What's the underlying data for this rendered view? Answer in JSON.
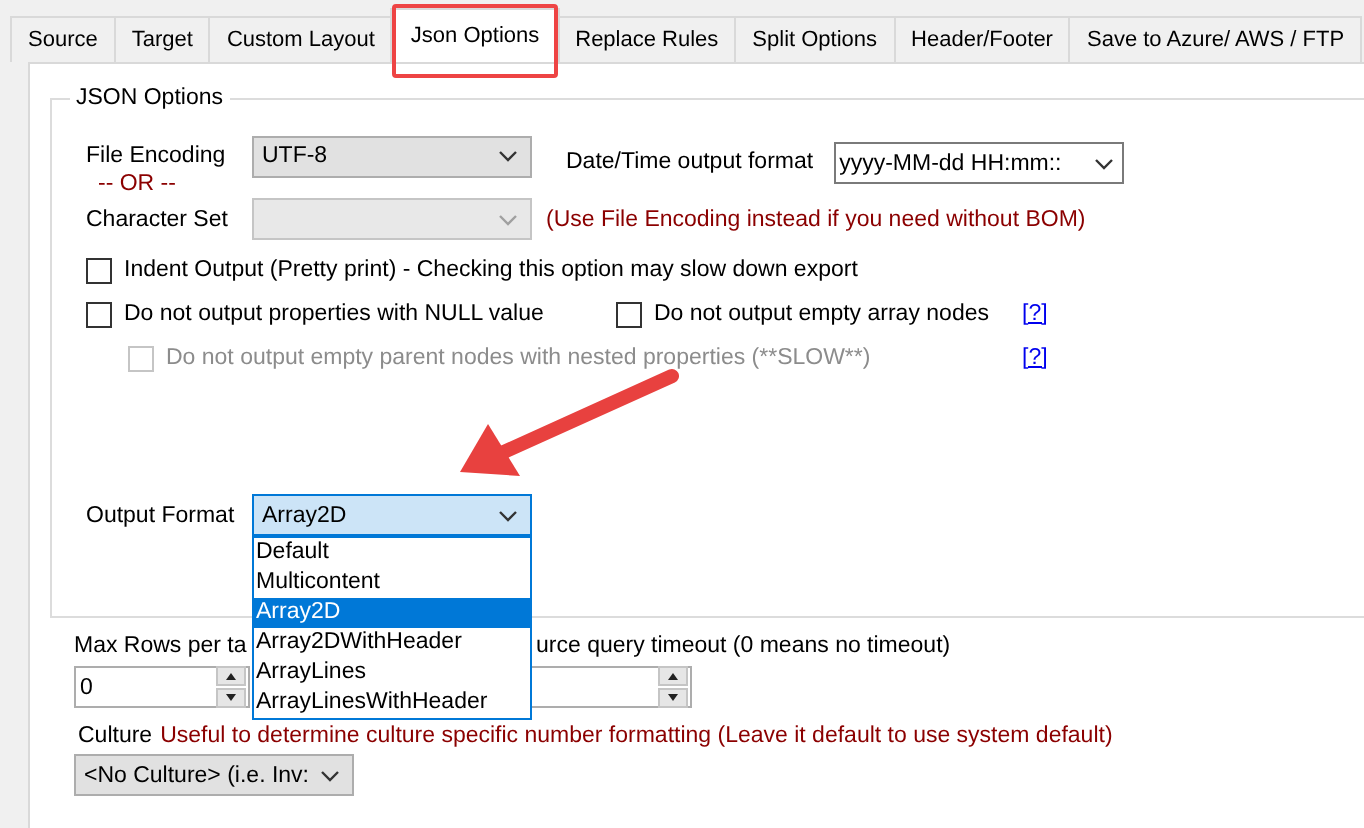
{
  "tabs": [
    {
      "label": "Source",
      "selected": false
    },
    {
      "label": "Target",
      "selected": false
    },
    {
      "label": "Custom Layout",
      "selected": false
    },
    {
      "label": "Json Options",
      "selected": true
    },
    {
      "label": "Replace Rules",
      "selected": false
    },
    {
      "label": "Split Options",
      "selected": false
    },
    {
      "label": "Header/Footer",
      "selected": false
    },
    {
      "label": "Save to Azure/ AWS / FTP",
      "selected": false
    }
  ],
  "group": {
    "title": "JSON Options",
    "file_encoding": {
      "label": "File Encoding",
      "value": "UTF-8"
    },
    "or_label": "-- OR --",
    "character_set": {
      "label": "Character Set",
      "disabled": true
    },
    "charset_hint": "(Use File Encoding instead if you need without BOM)",
    "datetime_format": {
      "label": "Date/Time output format",
      "value": "yyyy-MM-dd HH:mm::"
    },
    "option_rows": [
      {
        "items": [
          {
            "label": "Indent Output (Pretty print) - Checking this option may slow down export",
            "checked": false,
            "disabled": false
          }
        ]
      },
      {
        "items": [
          {
            "label": "Do not output properties with NULL value",
            "checked": false,
            "disabled": false
          },
          {
            "label": "Do not output empty array nodes",
            "checked": false,
            "disabled": false
          }
        ],
        "help": "[?]"
      },
      {
        "items": [
          {
            "label": "Do not output empty parent nodes with nested properties (**SLOW**)",
            "checked": false,
            "disabled": true
          }
        ],
        "help": "[?]"
      }
    ],
    "output_format": {
      "label": "Output Format",
      "value": "Array2D",
      "expanded": true,
      "options": [
        {
          "label": "Default",
          "selected": false
        },
        {
          "label": "Multicontent",
          "selected": false
        },
        {
          "label": "Array2D",
          "selected": true
        },
        {
          "label": "Array2DWithHeader",
          "selected": false
        },
        {
          "label": "ArrayLines",
          "selected": false
        },
        {
          "label": "ArrayLinesWithHeader",
          "selected": false
        }
      ]
    }
  },
  "max_rows": {
    "label": "Max Rows per ta",
    "value": "0"
  },
  "timeout": {
    "label": "urce query timeout (0 means no timeout)"
  },
  "culture": {
    "label": "Culture",
    "hint": "Useful to determine culture specific number formatting (Leave it default to use system default)",
    "value": "<No Culture> (i.e. Inv:"
  }
}
